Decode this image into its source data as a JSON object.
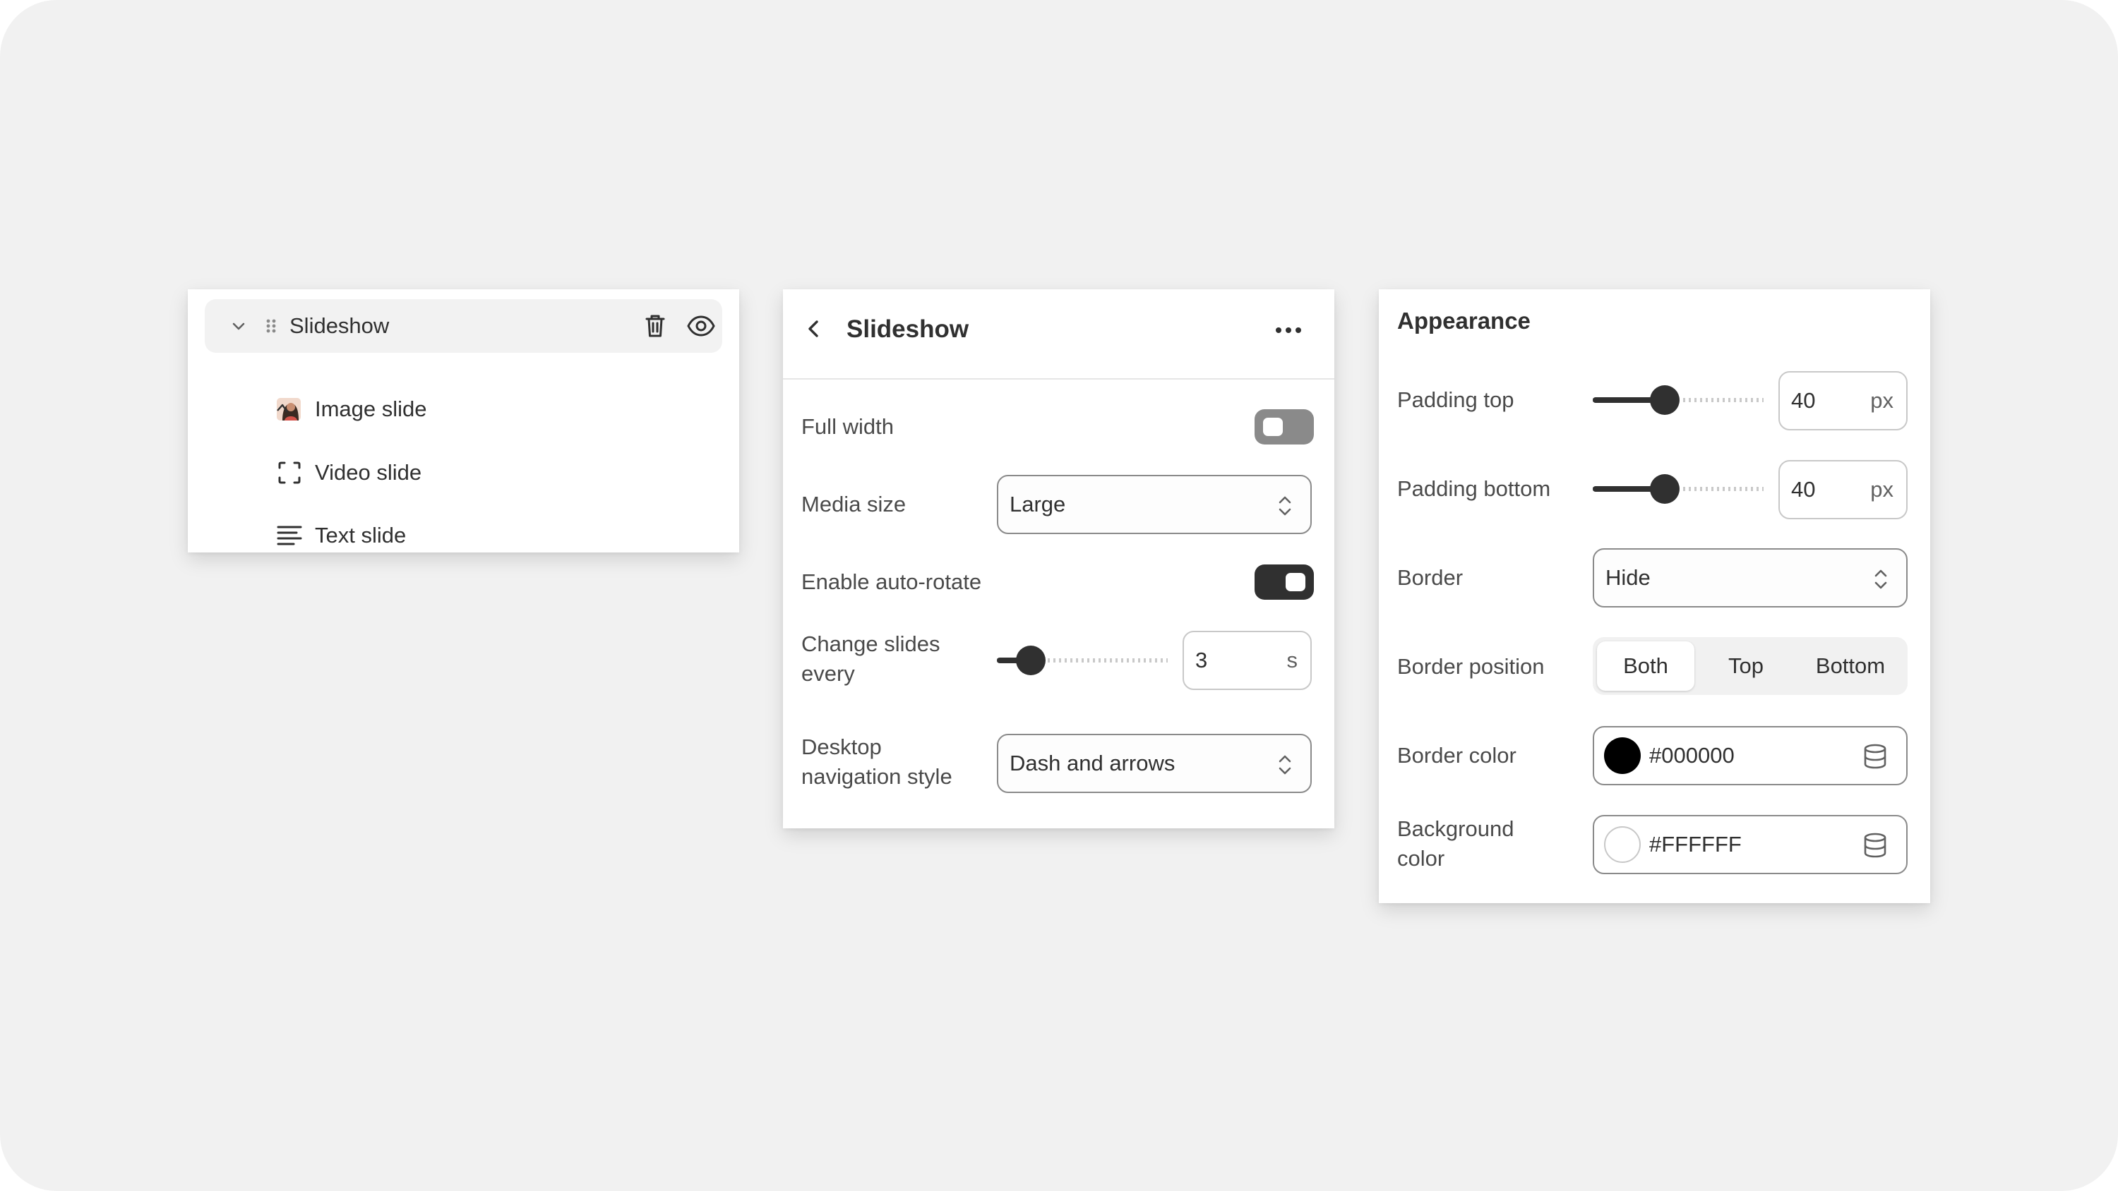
{
  "tree": {
    "title": "Slideshow",
    "items": [
      {
        "label": "Image slide",
        "icon": "image-thumbnail-icon"
      },
      {
        "label": "Video slide",
        "icon": "video-frame-icon"
      },
      {
        "label": "Text slide",
        "icon": "text-lines-icon"
      }
    ]
  },
  "settings": {
    "title": "Slideshow",
    "full_width_label": "Full width",
    "full_width_on": false,
    "media_size_label": "Media size",
    "media_size_value": "Large",
    "auto_rotate_label": "Enable auto-rotate",
    "auto_rotate_on": true,
    "change_slides_label_1": "Change slides",
    "change_slides_label_2": "every",
    "change_slides_value": "3",
    "change_slides_unit": "s",
    "change_slides_level": 0.2,
    "nav_style_label_1": "Desktop",
    "nav_style_label_2": "navigation style",
    "nav_style_value": "Dash and arrows"
  },
  "appearance": {
    "title": "Appearance",
    "padding_top_label": "Padding top",
    "padding_top_value": "40",
    "padding_top_unit": "px",
    "padding_top_level": 0.42,
    "padding_bottom_label": "Padding bottom",
    "padding_bottom_value": "40",
    "padding_bottom_unit": "px",
    "padding_bottom_level": 0.42,
    "border_label": "Border",
    "border_value": "Hide",
    "border_position_label": "Border position",
    "border_position_options": [
      "Both",
      "Top",
      "Bottom"
    ],
    "border_position_selected": "Both",
    "border_color_label": "Border color",
    "border_color_value": "#000000",
    "background_color_label_1": "Background",
    "background_color_label_2": "color",
    "background_color_value": "#FFFFFF"
  },
  "colors": {
    "canvas": "#f1f1f1",
    "text": "#303030",
    "toggle_on": "#303030",
    "toggle_off": "#8a8a8a"
  }
}
